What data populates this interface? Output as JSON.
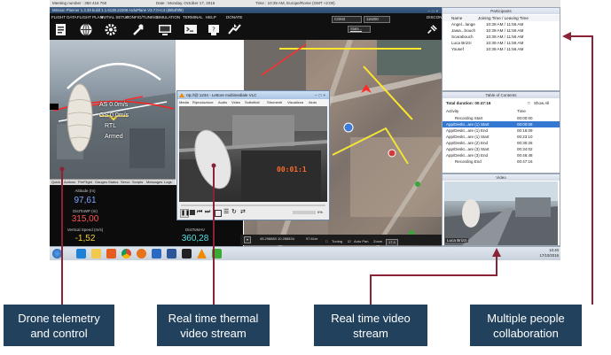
{
  "session_bar": {
    "meeting": "Meeting number : 350 416 760",
    "date": "Date : Monday, October 17, 2016",
    "time": "Time : 10:39 AM, Europe/Rome (GMT +2:00)"
  },
  "mission_planner": {
    "title": "Mission Planner 1.3.39 build 1.1.6138.22208 ArduPlane V3.7.0-rc4 (d9b4f9f8)",
    "menu": [
      {
        "label": "FLIGHT DATA",
        "icon": "flight-data-icon"
      },
      {
        "label": "FLIGHT PLAN",
        "icon": "flight-plan-icon"
      },
      {
        "label": "INITIAL SETUP",
        "icon": "initial-setup-icon"
      },
      {
        "label": "CONFIG/TUNING",
        "icon": "config-tuning-icon"
      },
      {
        "label": "SIMULATION",
        "icon": "simulation-icon"
      },
      {
        "label": "TERMINAL",
        "icon": "terminal-icon"
      },
      {
        "label": "HELP",
        "icon": "help-icon"
      },
      {
        "label": "DONATE",
        "icon": "donate-icon"
      }
    ],
    "com_port": "COM3",
    "baud": "115200",
    "stats_label": "Stats...",
    "disconnect_label": "DISCON",
    "hud": {
      "lines": [
        "AS 0.0m/s",
        "GS 0.0m/s",
        "RTL",
        "Armed"
      ]
    },
    "hud_tabs": [
      "Quick",
      "Actions",
      "PreFlight",
      "Gauges",
      "Status",
      "Servo",
      "Scripts",
      "Messages",
      "Logs",
      "DataFlash Logs",
      "Telemetry Logs"
    ],
    "quick": [
      {
        "label": "Altitude (m)",
        "value": "97,61",
        "color": "#7fa6ff"
      },
      {
        "label": "DistToWP (m)",
        "value": "315,00",
        "color": "#ff5353"
      },
      {
        "label": "Vertical Speed (m/s)",
        "value": "-1,52",
        "color": "#f2d13a"
      },
      {
        "label": "DistToMAV",
        "value": "360,28",
        "color": "#55e0e0"
      }
    ],
    "map_status": {
      "zoom_label": "Zoom",
      "zoom_value": "17.4",
      "coords": "45.298883 10.288834",
      "alt": "97.61m",
      "tuning_label": "Tuning",
      "autopan_label": "Auto Pan"
    }
  },
  "vlc": {
    "title": "rtp://@:1234 - Lettore multimediale VLC",
    "menu": [
      "Media",
      "Riproduzione",
      "Audio",
      "Video",
      "Sottotitoli",
      "Strumenti",
      "Visualizza",
      "Aiuto"
    ],
    "overlay_time": "00:01:1",
    "volume": "0%"
  },
  "participants": {
    "header": "Participants",
    "col_name": "Name",
    "col_time": "Joining Time / Leaving Time",
    "rows": [
      {
        "name": "Angel...lange",
        "time": "10:39 AM / 11:56 AM"
      },
      {
        "name": "Jawa...bouch",
        "time": "10:39 AM / 11:56 AM"
      },
      {
        "name": "Scarabouch",
        "time": "10:39 AM / 11:56 AM"
      },
      {
        "name": "Luca Brizzi",
        "time": "10:39 AM / 11:56 AM"
      },
      {
        "name": "Yousef",
        "time": "10:39 AM / 11:56 AM"
      }
    ]
  },
  "toc": {
    "header": "Table of Contents",
    "total_label": "Total duration: 00:47:16",
    "show_all": "Show All",
    "col_activity": "Activity",
    "col_time": "Time",
    "rows": [
      {
        "activity": "Recording Start",
        "time": "00:00:00"
      },
      {
        "activity": "App/Deskt...are (1) Start",
        "time": "00:00:08"
      },
      {
        "activity": "App/Deskt...are (1) End",
        "time": "00:16:09"
      },
      {
        "activity": "App/Deskt...are (1) Start",
        "time": "00:23:10"
      },
      {
        "activity": "App/Deskt...are (2) End",
        "time": "00:30:26"
      },
      {
        "activity": "App/Deskt...are (3) Start",
        "time": "00:34:02"
      },
      {
        "activity": "App/Deskt...are (3) End",
        "time": "00:46:48"
      },
      {
        "activity": "Recording End",
        "time": "00:47:16"
      }
    ],
    "selected_index": 1
  },
  "video_panel": {
    "header": "Video",
    "speaker": "Luca Brizzi"
  },
  "taskbar": {
    "icons": [
      "start-orb-icon",
      "ie-icon",
      "explorer-icon",
      "media-player-icon",
      "chrome-icon",
      "firefox-icon",
      "outlook-icon",
      "word-icon",
      "mission-planner-icon",
      "vlc-icon",
      "webex-icon"
    ],
    "time": "10:40",
    "date": "17/10/2016"
  },
  "callouts": [
    {
      "text": "Drone telemetry and control"
    },
    {
      "text": "Real time thermal video stream"
    },
    {
      "text": "Real time video stream"
    },
    {
      "text": "Multiple people collaboration"
    }
  ],
  "colors": {
    "callout_bg": "#21415d",
    "leader_line": "#8a2338",
    "selection": "#3478d1"
  }
}
